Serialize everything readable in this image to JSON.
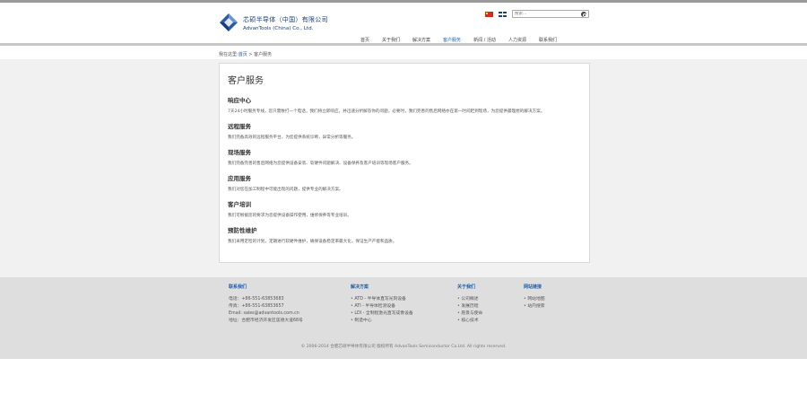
{
  "header": {
    "brand_cn": "芯硕半导体（中国）有限公司",
    "brand_en": "AdvanTools (China) Co., Ltd.",
    "search_placeholder": "搜索..."
  },
  "nav": [
    "首页",
    "关于我们",
    "解决方案",
    "客户服务",
    "新闻 / 活动",
    "人力资源",
    "联系我们"
  ],
  "nav_active": 3,
  "breadcrumb": {
    "prefix": "我在这里:",
    "home": "首页",
    "sep": " > ",
    "current": "客户服务"
  },
  "content": {
    "title": "客户服务",
    "sections": [
      {
        "heading": "响应中心",
        "text": "7天24小时服务专线，您只需致打一个电话，我们将立即响应，并迅速分析解答你的问题，必要时，我们完善的售后网络亦在第一时间赶到现场，为您提供最理想的解决方案。"
      },
      {
        "heading": "远程服务",
        "text": "我们完备高效的远程服务平台，为您提供系统诊断，异常分析等服务。"
      },
      {
        "heading": "现场服务",
        "text": "我们完备完善的售后网络为您提供设备安装、软硬件问题解决、设备保养及客户培训等现场客户服务。"
      },
      {
        "heading": "应用服务",
        "text": "我们对您在加工制程中可能出现的问题，提供专业的解决方案。"
      },
      {
        "heading": "客户培训",
        "text": "我们可根据您的要求为您提供设备操作使用，维修保养等专业培训。"
      },
      {
        "heading": "预防性维护",
        "text": "我们采用定检的计划，定期进行软硬件维护，确保设备稳定率最大化，保证生产产能和品质。"
      }
    ]
  },
  "footer": {
    "contact": {
      "title": "联系我们",
      "lines": [
        "电话：+86-551-63853683",
        "传真：+86-551-63853657",
        "Email: sales@advantools.com.cn",
        "地址：合肥市经济开发区莲德大道68号"
      ]
    },
    "solutions": {
      "title": "解决方案",
      "lines": [
        "ATD - 半导体直写光刻设备",
        "ATI - 半导体检测设备",
        "LDI - 全制程激光直写成像设备",
        "制造中心"
      ]
    },
    "about": {
      "title": "关于我们",
      "lines": [
        "公司概述",
        "发展历程",
        "愿景与使命",
        "核心技术"
      ]
    },
    "sitemap": {
      "title": "网站链接",
      "lines": [
        "网站地图",
        "站内搜索"
      ]
    },
    "copyright": "© 2006-2014 合肥芯硕半导体有限公司 版权所有 AdvanTools Semiconductor Co.Ltd. All rights reserved."
  },
  "colors": {
    "accent": "#1d5fae",
    "brand": "#1d3f7a",
    "footer_bg": "#dedede"
  }
}
